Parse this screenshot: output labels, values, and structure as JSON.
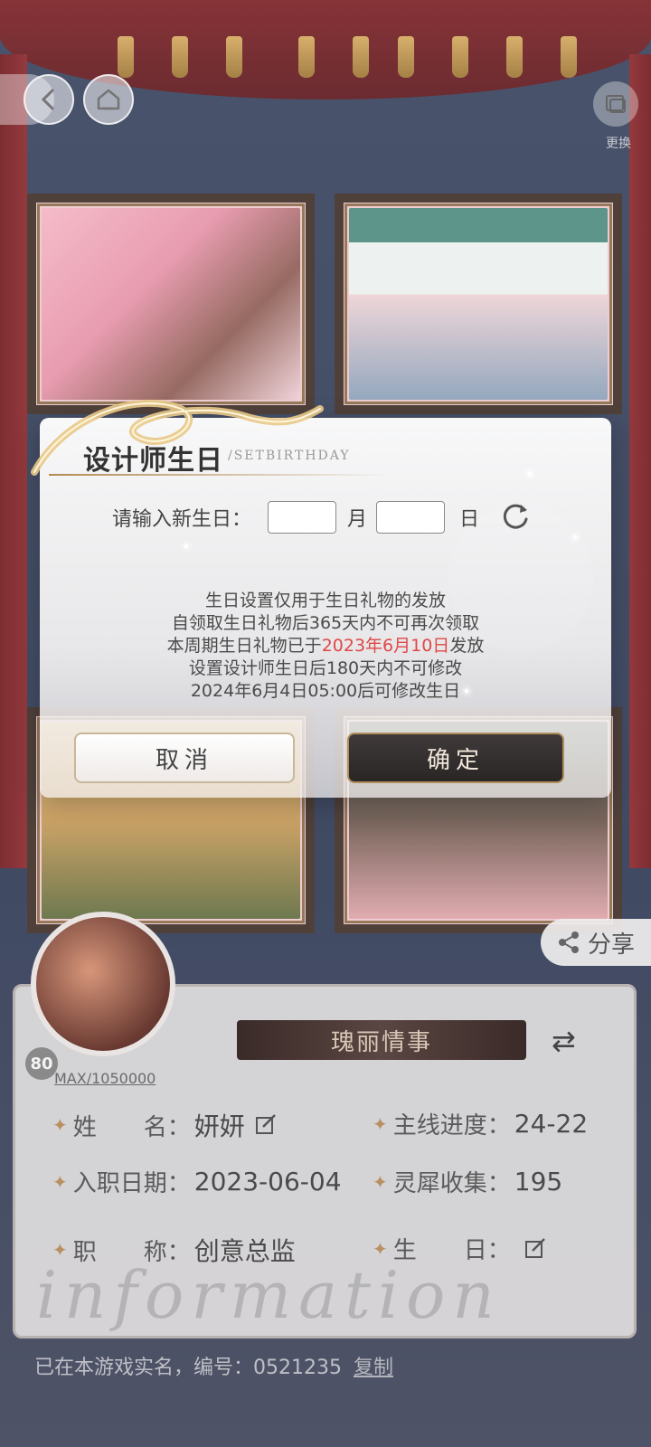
{
  "nav": {
    "switch_label": "更换"
  },
  "modal": {
    "title": "设计师生日",
    "subtitle": "/SETBIRTHDAY",
    "prompt": "请输入新生日：",
    "month_value": "",
    "month_label": "月",
    "day_value": "",
    "day_label": "日",
    "notice_line1": "生日设置仅用于生日礼物的发放",
    "notice_line2": "自领取生日礼物后365天内不可再次领取",
    "notice_line3_prefix": "本周期生日礼物已于",
    "notice_line3_date": "2023年6月10日",
    "notice_line3_suffix": "发放",
    "notice_line4": "设置设计师生日后180天内不可修改",
    "notice_line5": "2024年6月4日05:00后可修改生日",
    "cancel_label": "取消",
    "confirm_label": "确定",
    "highlight_color": "#e04848"
  },
  "share": {
    "label": "分享"
  },
  "profile": {
    "level": "80",
    "exp": "MAX/1050000",
    "title_banner": "瑰丽情事",
    "rows": {
      "name_key": "姓　　名：",
      "name_val": "妍妍",
      "progress_key": "主线进度：",
      "progress_val": "24-22",
      "join_key": "入职日期：",
      "join_val": "2023-06-04",
      "collect_key": "灵犀收集：",
      "collect_val": "195",
      "role_key": "职　　称：",
      "role_val": "创意总监",
      "birthday_key": "生　　日：",
      "birthday_val": ""
    },
    "watermark": "information",
    "realname_text": "已在本游戏实名，编号：0521235",
    "copy_label": "复制"
  },
  "colors": {
    "curtain": "#7a1b1f",
    "gold": "#b28a52",
    "confirm_bg": "#2a2626"
  }
}
